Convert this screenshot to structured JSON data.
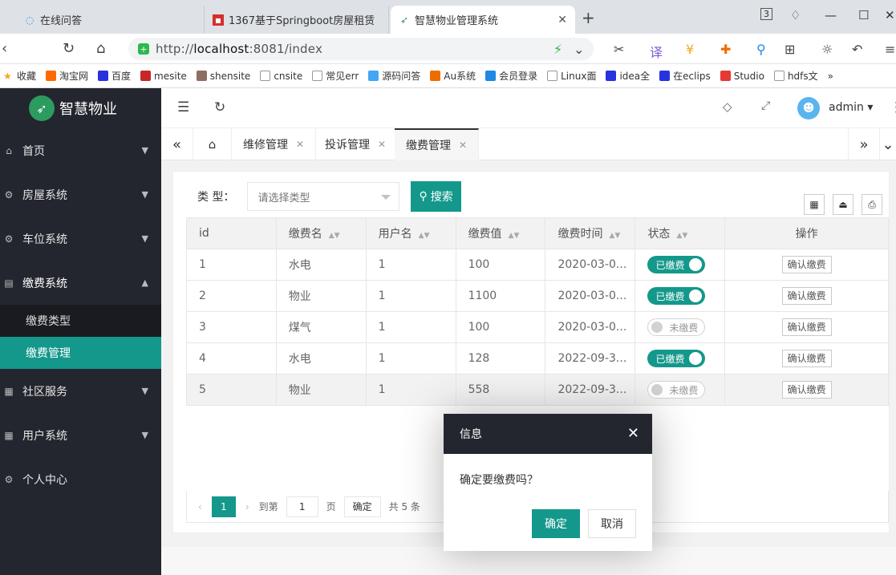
{
  "browser": {
    "tabs": [
      {
        "title": "在线问答",
        "icon": "globe-icon"
      },
      {
        "title": "1367基于Springboot房屋租赁",
        "icon": "red-square-icon"
      },
      {
        "title": "智慧物业管理系统",
        "icon": "rocket-icon"
      }
    ],
    "tab_count": "3",
    "url_prefix": "http://",
    "url_host": "localhost",
    "url_rest": ":8081/index",
    "bookmarks": [
      "收藏",
      "淘宝网",
      "百度",
      "mesite",
      "shensite",
      "cnsite",
      "常见err",
      "源码问答",
      "Au系统",
      "会员登录",
      "Linux面",
      "idea全",
      "在eclips",
      "Studio",
      "hdfs文"
    ]
  },
  "sidebar": {
    "brand": "智慧物业",
    "items": [
      {
        "label": "首页",
        "icon": "home-icon"
      },
      {
        "label": "房屋系统",
        "icon": "gear-icon"
      },
      {
        "label": "车位系统",
        "icon": "car-icon"
      },
      {
        "label": "缴费系统",
        "icon": "bill-icon",
        "expanded": true,
        "children": [
          {
            "label": "缴费类型"
          },
          {
            "label": "缴费管理",
            "active": true
          }
        ]
      },
      {
        "label": "社区服务",
        "icon": "grid-icon"
      },
      {
        "label": "用户系统",
        "icon": "user-grid-icon"
      },
      {
        "label": "个人中心",
        "icon": "cog-icon"
      }
    ]
  },
  "topbar": {
    "username": "admin"
  },
  "pagetabs": [
    {
      "label": "维修管理"
    },
    {
      "label": "投诉管理"
    },
    {
      "label": "缴费管理",
      "active": true
    }
  ],
  "search": {
    "label": "类 型：",
    "placeholder": "请选择类型",
    "button": "搜索"
  },
  "table": {
    "columns": [
      "id",
      "缴费名",
      "用户名",
      "缴费值",
      "缴费时间",
      "状态",
      "操作"
    ],
    "rows": [
      {
        "id": "1",
        "name": "水电",
        "user": "1",
        "value": "100",
        "time": "2020-03-0...",
        "status": "已缴费",
        "paid": true
      },
      {
        "id": "2",
        "name": "物业",
        "user": "1",
        "value": "1100",
        "time": "2020-03-0...",
        "status": "已缴费",
        "paid": true
      },
      {
        "id": "3",
        "name": "煤气",
        "user": "1",
        "value": "100",
        "time": "2020-03-0...",
        "status": "未缴费",
        "paid": false
      },
      {
        "id": "4",
        "name": "水电",
        "user": "1",
        "value": "128",
        "time": "2022-09-3...",
        "status": "已缴费",
        "paid": true
      },
      {
        "id": "5",
        "name": "物业",
        "user": "1",
        "value": "558",
        "time": "2022-09-3...",
        "status": "未缴费",
        "paid": false
      }
    ],
    "action_label": "确认缴费"
  },
  "pager": {
    "current": "1",
    "goto_label": "到第",
    "goto_value": "1",
    "page_label": "页",
    "ok": "确定",
    "total": "共 5 条"
  },
  "dialog": {
    "title": "信息",
    "message": "确定要缴费吗？",
    "ok": "确定",
    "cancel": "取消"
  }
}
